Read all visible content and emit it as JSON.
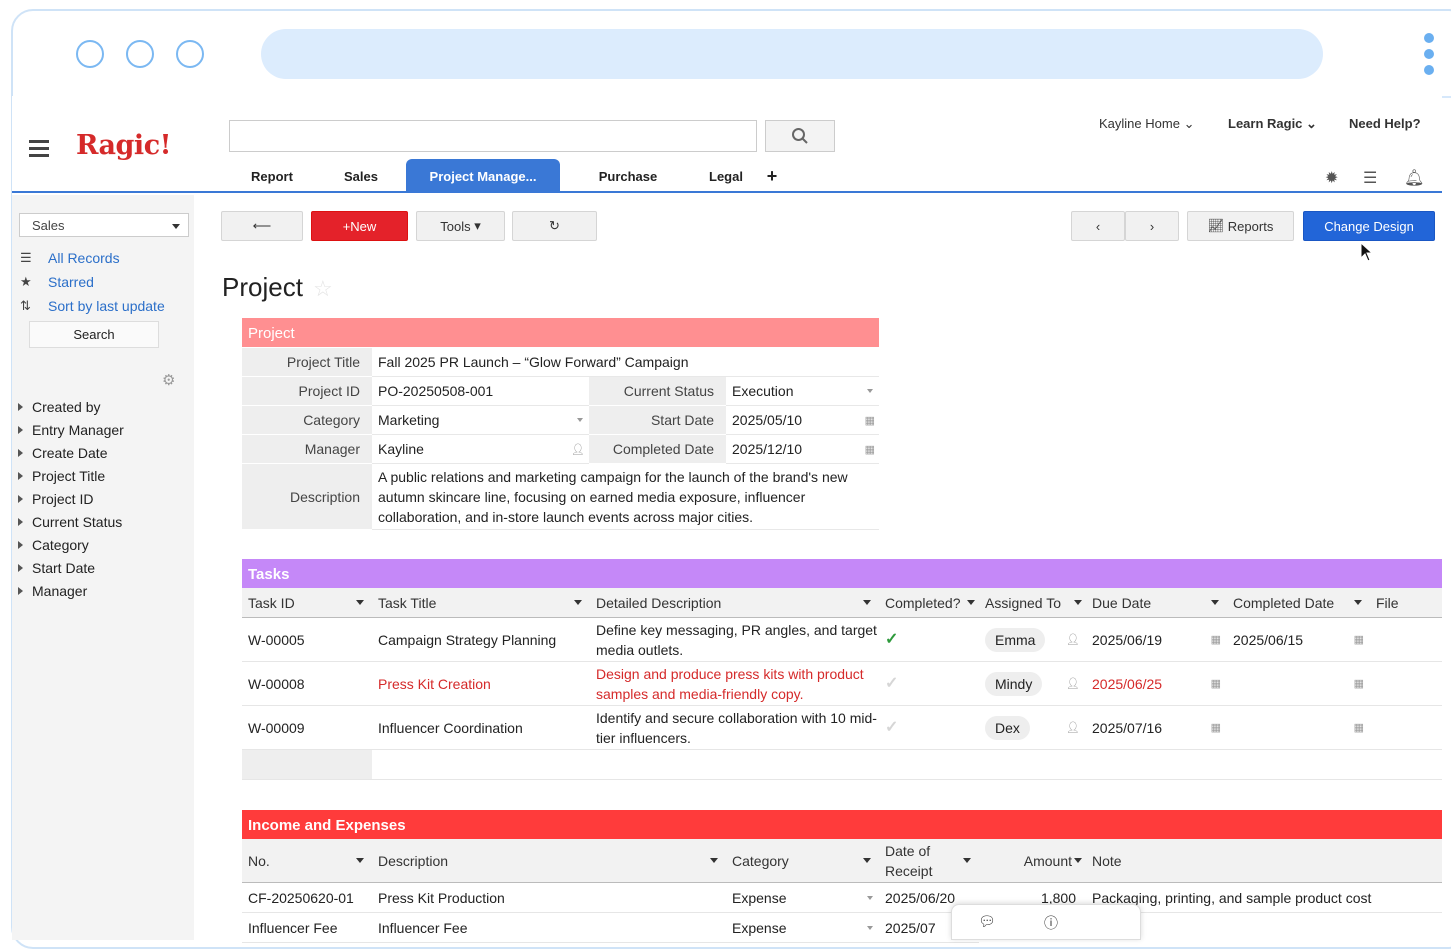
{
  "colors": {
    "brand": "#d52a2a",
    "accent": "#3a78d6",
    "project_header": "#ff8f91",
    "tasks_header": "#c588f8",
    "income_header": "#ff3b3b",
    "overdue": "#d52a2a"
  },
  "app": {
    "logo": "Ragic!"
  },
  "header": {
    "links": [
      "Kayline Home",
      "Learn Ragic",
      "Need Help?"
    ],
    "tabs": [
      "Report",
      "Sales",
      "Project Manage...",
      "Purchase",
      "Legal",
      "+"
    ],
    "active_tab": "Project Manage..."
  },
  "sidebar": {
    "selected_sheet": "Sales",
    "links": [
      "All Records",
      "Starred",
      "Sort by last update"
    ],
    "search_label": "Search",
    "filters": [
      "Created by",
      "Entry Manager",
      "Create Date",
      "Project Title",
      "Project ID",
      "Current Status",
      "Category",
      "Start Date",
      "Manager"
    ]
  },
  "toolbar": {
    "new": "+New",
    "tools": "Tools",
    "reports": "Reports",
    "change_design": "Change Design"
  },
  "page_title": "Project",
  "project": {
    "header": "Project",
    "fields": {
      "project_title": {
        "label": "Project Title",
        "value": "Fall 2025 PR Launch – “Glow Forward” Campaign"
      },
      "project_id": {
        "label": "Project ID",
        "value": "PO-20250508-001"
      },
      "current_status": {
        "label": "Current Status",
        "value": "Execution"
      },
      "category": {
        "label": "Category",
        "value": "Marketing"
      },
      "start_date": {
        "label": "Start Date",
        "value": "2025/05/10"
      },
      "manager": {
        "label": "Manager",
        "value": "Kayline"
      },
      "completed_date": {
        "label": "Completed Date",
        "value": "2025/12/10"
      },
      "description": {
        "label": "Description",
        "value": "A public relations and marketing campaign for the launch of the brand's new autumn skincare line, focusing on earned media exposure, influencer collaboration, and in-store launch events across major cities."
      }
    }
  },
  "tasks": {
    "header": "Tasks",
    "columns": [
      "Task ID",
      "Task Title",
      "Detailed Description",
      "Completed?",
      "Assigned To",
      "Due Date",
      "Completed Date",
      "File"
    ],
    "rows": [
      {
        "id": "W-00005",
        "title": "Campaign Strategy Planning",
        "desc": "Define key messaging, PR angles, and target media outlets.",
        "completed": true,
        "assigned": "Emma",
        "due": "2025/06/19",
        "completed_date": "2025/06/15"
      },
      {
        "id": "W-00008",
        "title": "Press Kit Creation",
        "desc": "Design and produce press kits with product samples and media-friendly copy.",
        "completed": false,
        "assigned": "Mindy",
        "due": "2025/06/25",
        "completed_date": ""
      },
      {
        "id": "W-00009",
        "title": "Influencer Coordination",
        "desc": "Identify and secure collaboration with 10 mid-tier influencers.",
        "completed": false,
        "assigned": "Dex",
        "due": "2025/07/16",
        "completed_date": ""
      }
    ]
  },
  "income": {
    "header": "Income and Expenses",
    "columns": [
      "No.",
      "Description",
      "Category",
      "Date of Receipt",
      "Amount",
      "Note"
    ],
    "rows": [
      {
        "no": "CF-20250620-01",
        "desc": "Press Kit Production",
        "category": "Expense",
        "date": "2025/06/20",
        "amount": "1,800",
        "note": "Packaging, printing, and sample product cost"
      },
      {
        "no": "Influencer Fee",
        "desc": "Influencer Fee",
        "category": "Expense",
        "date": "2025/07",
        "amount": "",
        "note": ""
      }
    ]
  }
}
